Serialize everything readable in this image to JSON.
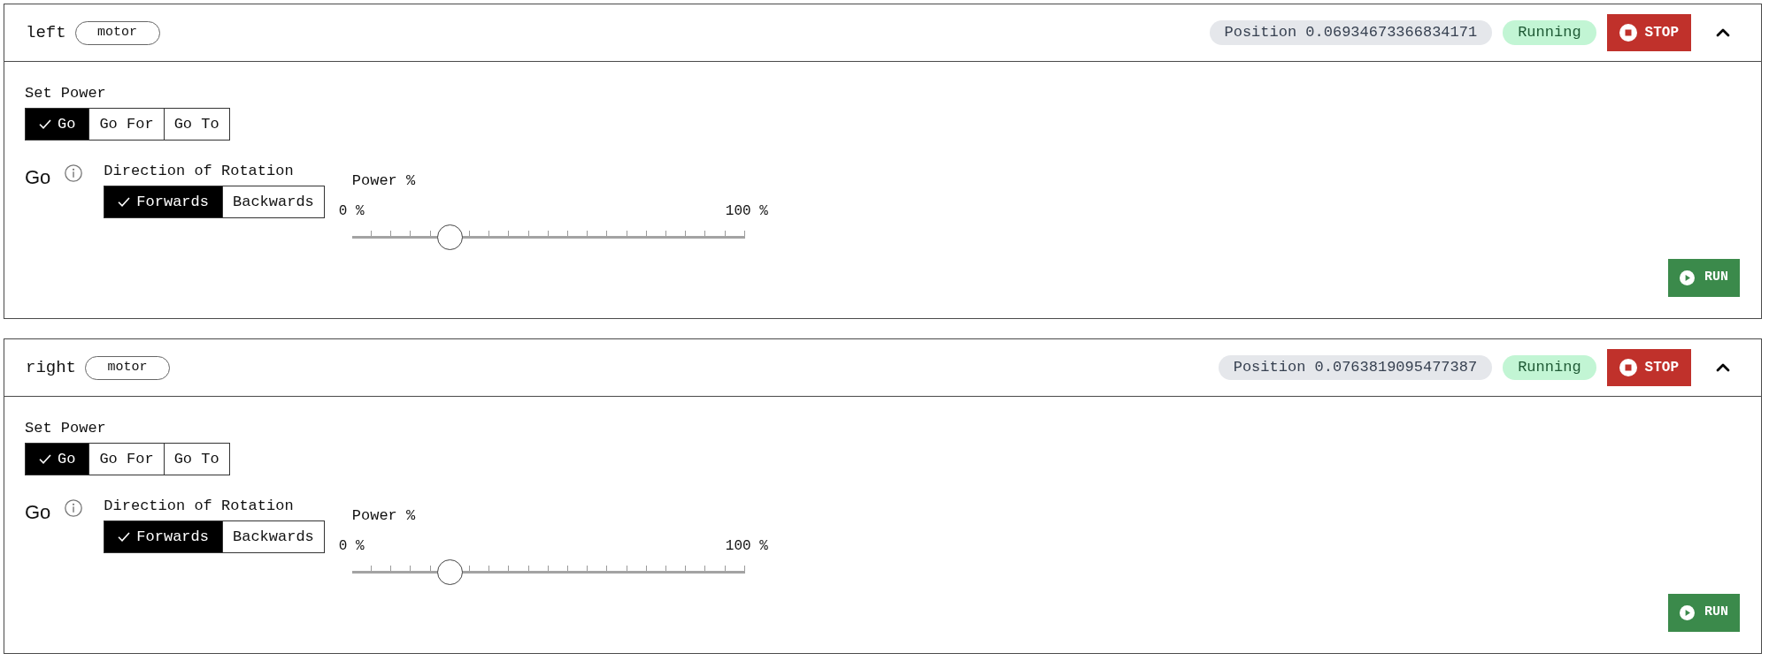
{
  "motors": [
    {
      "name": "left",
      "tag": "motor",
      "position": "Position 0.06934673366834171",
      "status": "Running",
      "stop_label": "STOP",
      "expanded": true,
      "set_power": {
        "label": "Set Power",
        "options": [
          {
            "label": "Go",
            "selected": true
          },
          {
            "label": "Go For",
            "selected": false
          },
          {
            "label": "Go To",
            "selected": false
          }
        ]
      },
      "mode": {
        "title": "Go",
        "direction": {
          "label": "Direction of Rotation",
          "options": [
            {
              "label": "Forwards",
              "selected": true
            },
            {
              "label": "Backwards",
              "selected": false
            }
          ]
        },
        "power": {
          "label": "Power %",
          "min_label": "0 %",
          "max_label": "100 %",
          "level": 0.25
        }
      },
      "run_label": "RUN"
    },
    {
      "name": "right",
      "tag": "motor",
      "position": "Position 0.0763819095477387",
      "status": "Running",
      "stop_label": "STOP",
      "expanded": true,
      "set_power": {
        "label": "Set Power",
        "options": [
          {
            "label": "Go",
            "selected": true
          },
          {
            "label": "Go For",
            "selected": false
          },
          {
            "label": "Go To",
            "selected": false
          }
        ]
      },
      "mode": {
        "title": "Go",
        "direction": {
          "label": "Direction of Rotation",
          "options": [
            {
              "label": "Forwards",
              "selected": true
            },
            {
              "label": "Backwards",
              "selected": false
            }
          ]
        },
        "power": {
          "label": "Power %",
          "min_label": "0 %",
          "max_label": "100 %",
          "level": 0.25
        }
      },
      "run_label": "RUN"
    }
  ]
}
